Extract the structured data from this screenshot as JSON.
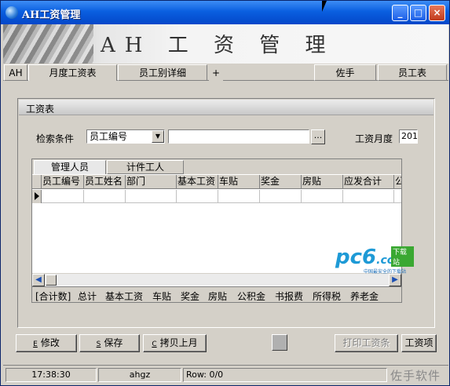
{
  "window": {
    "title": "AH工资管理",
    "min_glyph": "_",
    "max_glyph": "□",
    "close_glyph": "×"
  },
  "banner": {
    "title": "AH 工 资 管 理"
  },
  "tabs": {
    "ah": "AH",
    "monthly": "月度工资表",
    "by_employee": "员工别详细",
    "add": "+",
    "assistant": "佐手",
    "employee_table": "员工表"
  },
  "panel": {
    "title": "工资表"
  },
  "search": {
    "label": "检索条件",
    "field_value": "员工编号",
    "text_value": "",
    "ellipsis": "...",
    "month_label": "工资月度",
    "month_value": "201"
  },
  "grid": {
    "subtabs": [
      "管理人员",
      "计件工人"
    ],
    "columns": [
      "员工编号",
      "员工姓名",
      "部门",
      "基本工资",
      "车贴",
      "奖金",
      "房贴",
      "应发合计",
      "公"
    ],
    "totals": [
      "[合计数]",
      "总计",
      "基本工资",
      "车贴",
      "奖金",
      "房贴",
      "公积金",
      "书报费",
      "所得税",
      "养老金"
    ]
  },
  "watermark_logo": {
    "main": "pc6",
    "suffix": ".com",
    "badge": "下载站",
    "sub": "中国最安全的下载站"
  },
  "buttons": {
    "edit": {
      "key": "E",
      "label": "修改"
    },
    "save": {
      "key": "S",
      "label": "保存"
    },
    "copy_last_month": {
      "key": "C",
      "label": "拷贝上月"
    },
    "print": "打印工资条",
    "salary_item": "工资项"
  },
  "status": {
    "time": "17:38:30",
    "user": "ahgz",
    "row": "Row: 0/0",
    "watermark": "佐手软件"
  },
  "colors": {
    "face": "#d4d0c8",
    "titlebar": "#0a5fe0",
    "accent_logo": "#1e9ad6"
  }
}
